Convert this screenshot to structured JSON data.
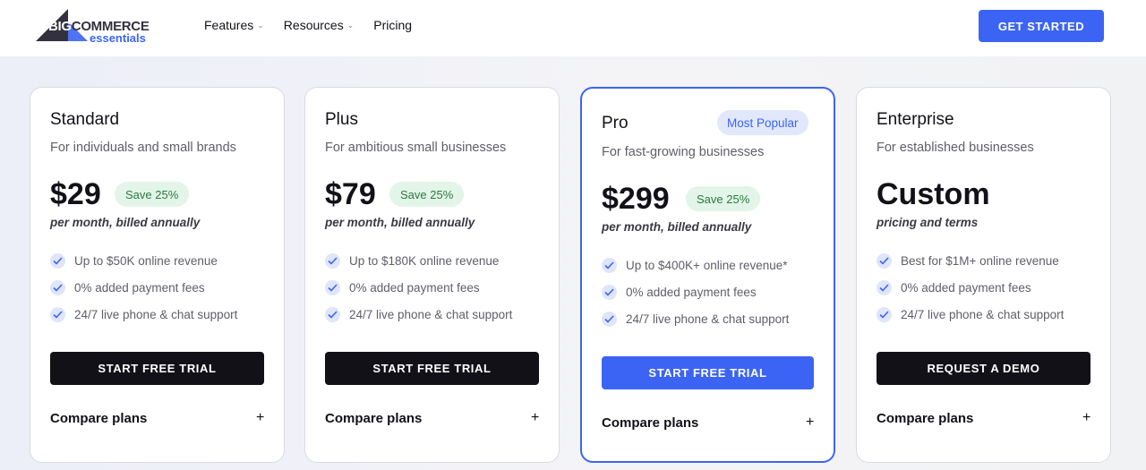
{
  "brand": {
    "name_prefix": "BIG",
    "name_suffix": "COMMERCE",
    "sub": "essentials"
  },
  "nav": {
    "items": [
      "Features",
      "Resources",
      "Pricing"
    ],
    "cta": "GET STARTED"
  },
  "colors": {
    "accent": "#3c64f4",
    "dark": "#121118",
    "save_bg": "#e2f5e8",
    "save_text": "#2c7a43"
  },
  "plans": [
    {
      "title": "Standard",
      "subtitle": "For individuals and small brands",
      "price": "$29",
      "save": "Save 25%",
      "billing": "per month, billed annually",
      "features": [
        "Up to $50K online revenue",
        "0% added payment fees",
        "24/7 live phone & chat support"
      ],
      "button": "START FREE TRIAL",
      "compare": "Compare plans",
      "toggle": "+"
    },
    {
      "title": "Plus",
      "subtitle": "For ambitious small businesses",
      "price": "$79",
      "save": "Save 25%",
      "billing": "per month, billed annually",
      "features": [
        "Up to $180K online revenue",
        "0% added payment fees",
        "24/7 live phone & chat support"
      ],
      "button": "START FREE TRIAL",
      "compare": "Compare plans",
      "toggle": "+"
    },
    {
      "title": "Pro",
      "badge": "Most Popular",
      "subtitle": "For fast-growing businesses",
      "price": "$299",
      "save": "Save 25%",
      "billing": "per month, billed annually",
      "features": [
        "Up to $400K+ online revenue*",
        "0% added payment fees",
        "24/7 live phone & chat support"
      ],
      "button": "START FREE TRIAL",
      "compare": "Compare plans",
      "toggle": "+"
    },
    {
      "title": "Enterprise",
      "subtitle": "For established businesses",
      "price": "Custom",
      "billing": "pricing and terms",
      "features": [
        "Best for $1M+ online revenue",
        "0% added payment fees",
        "24/7 live phone & chat support"
      ],
      "button": "REQUEST A DEMO",
      "compare": "Compare plans",
      "toggle": "+"
    }
  ]
}
